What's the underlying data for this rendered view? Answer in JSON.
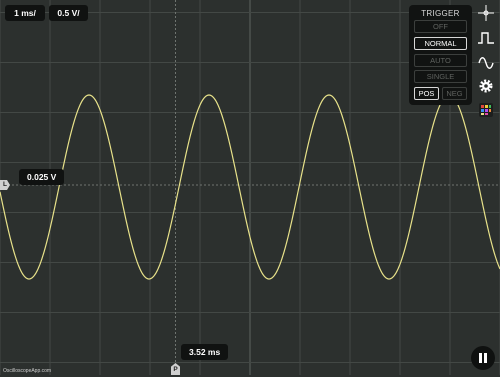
{
  "scale": {
    "timebase": "1 ms/",
    "volts": "0.5 V/"
  },
  "trigger": {
    "title": "TRIGGER",
    "modes": [
      {
        "label": "OFF",
        "active": false
      },
      {
        "label": "NORMAL",
        "active": true
      },
      {
        "label": "AUTO",
        "active": false
      },
      {
        "label": "SINGLE",
        "active": false
      }
    ],
    "slope": [
      {
        "label": "POS",
        "active": true
      },
      {
        "label": "NEG",
        "active": false
      }
    ],
    "level_readout": "0.025 V",
    "level_marker": "L",
    "time_readout": "3.52 ms",
    "time_marker": "P"
  },
  "toolbar": [
    "crosshair-icon",
    "pulse-icon",
    "sine-wave-icon",
    "gear-icon",
    "palette-icon"
  ],
  "watermark": "OscilloscopeApp.com",
  "colors": {
    "background": "#2c302e",
    "grid": "#434845",
    "trace": "#e8e28a",
    "panel": "#111312"
  },
  "trace": {
    "type": "sine",
    "divisions_per_cycle": 2.4,
    "amplitude_divisions": 2.0,
    "offset_divisions": 0
  }
}
